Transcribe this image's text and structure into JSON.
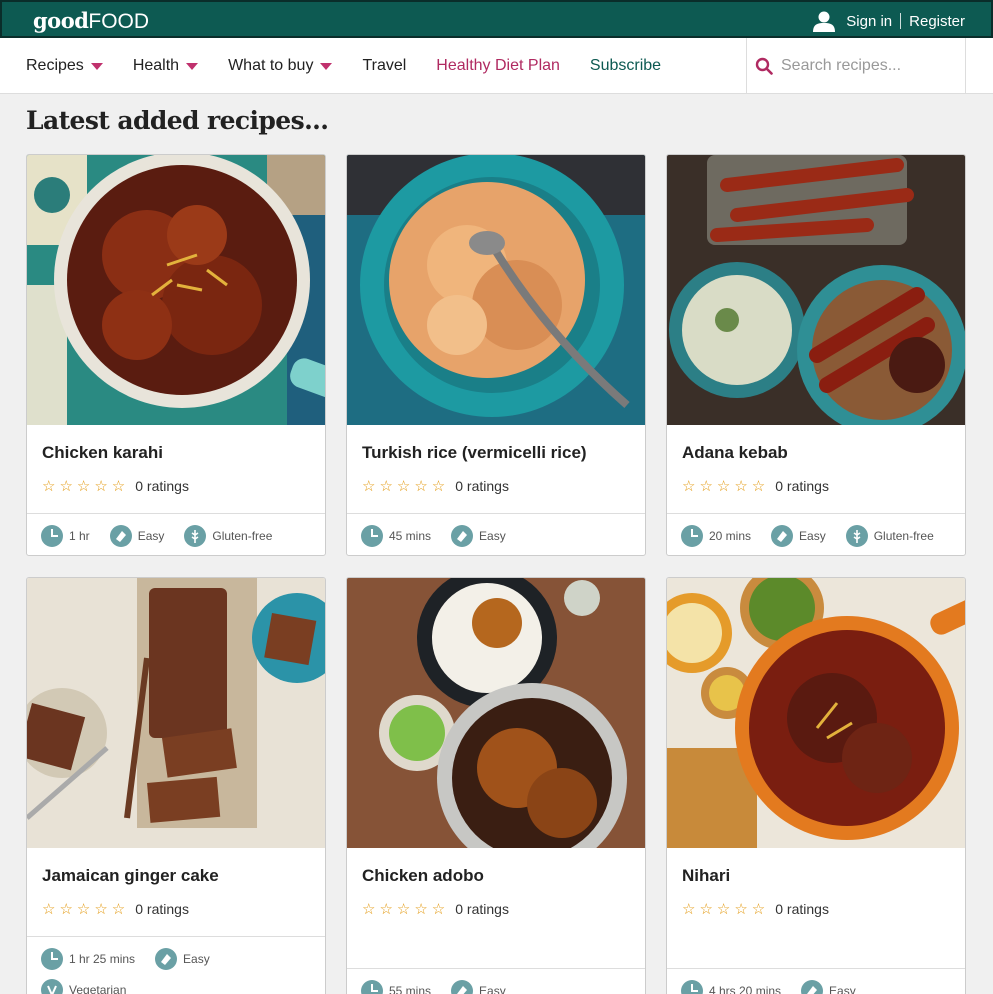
{
  "header": {
    "logo_good": "good",
    "logo_food": "FOOD",
    "sign_in": "Sign in",
    "register": "Register"
  },
  "nav": {
    "items": [
      {
        "label": "Recipes",
        "dropdown": true
      },
      {
        "label": "Health",
        "dropdown": true
      },
      {
        "label": "What to buy",
        "dropdown": true
      },
      {
        "label": "Travel",
        "dropdown": false
      },
      {
        "label": "Healthy Diet Plan",
        "dropdown": false
      },
      {
        "label": "Subscribe",
        "dropdown": false
      }
    ],
    "search_placeholder": "Search recipes..."
  },
  "page": {
    "heading": "Latest added recipes..."
  },
  "recipes": [
    {
      "title": "Chicken karahi",
      "ratings": "0 ratings",
      "time": "1 hr",
      "skill": "Easy",
      "diet": "Gluten-free",
      "diet_icon": "wheat-icon"
    },
    {
      "title": "Turkish rice (vermicelli rice)",
      "ratings": "0 ratings",
      "time": "45 mins",
      "skill": "Easy"
    },
    {
      "title": "Adana kebab",
      "ratings": "0 ratings",
      "time": "20 mins",
      "skill": "Easy",
      "diet": "Gluten-free",
      "diet_icon": "wheat-icon"
    },
    {
      "title": "Jamaican ginger cake",
      "ratings": "0 ratings",
      "time": "1 hr 25 mins",
      "skill": "Easy",
      "diet": "Vegetarian",
      "diet_icon": "vegetarian-icon"
    },
    {
      "title": "Chicken adobo",
      "ratings": "0 ratings",
      "time": "55 mins",
      "skill": "Easy"
    },
    {
      "title": "Nihari",
      "ratings": "0 ratings",
      "time": "4 hrs 20 mins",
      "skill": "Easy"
    }
  ],
  "colors": {
    "brand_green": "#0d5a52",
    "accent_pink": "#b02a61",
    "star": "#e39a12",
    "icon_teal": "#6aa0a5"
  }
}
